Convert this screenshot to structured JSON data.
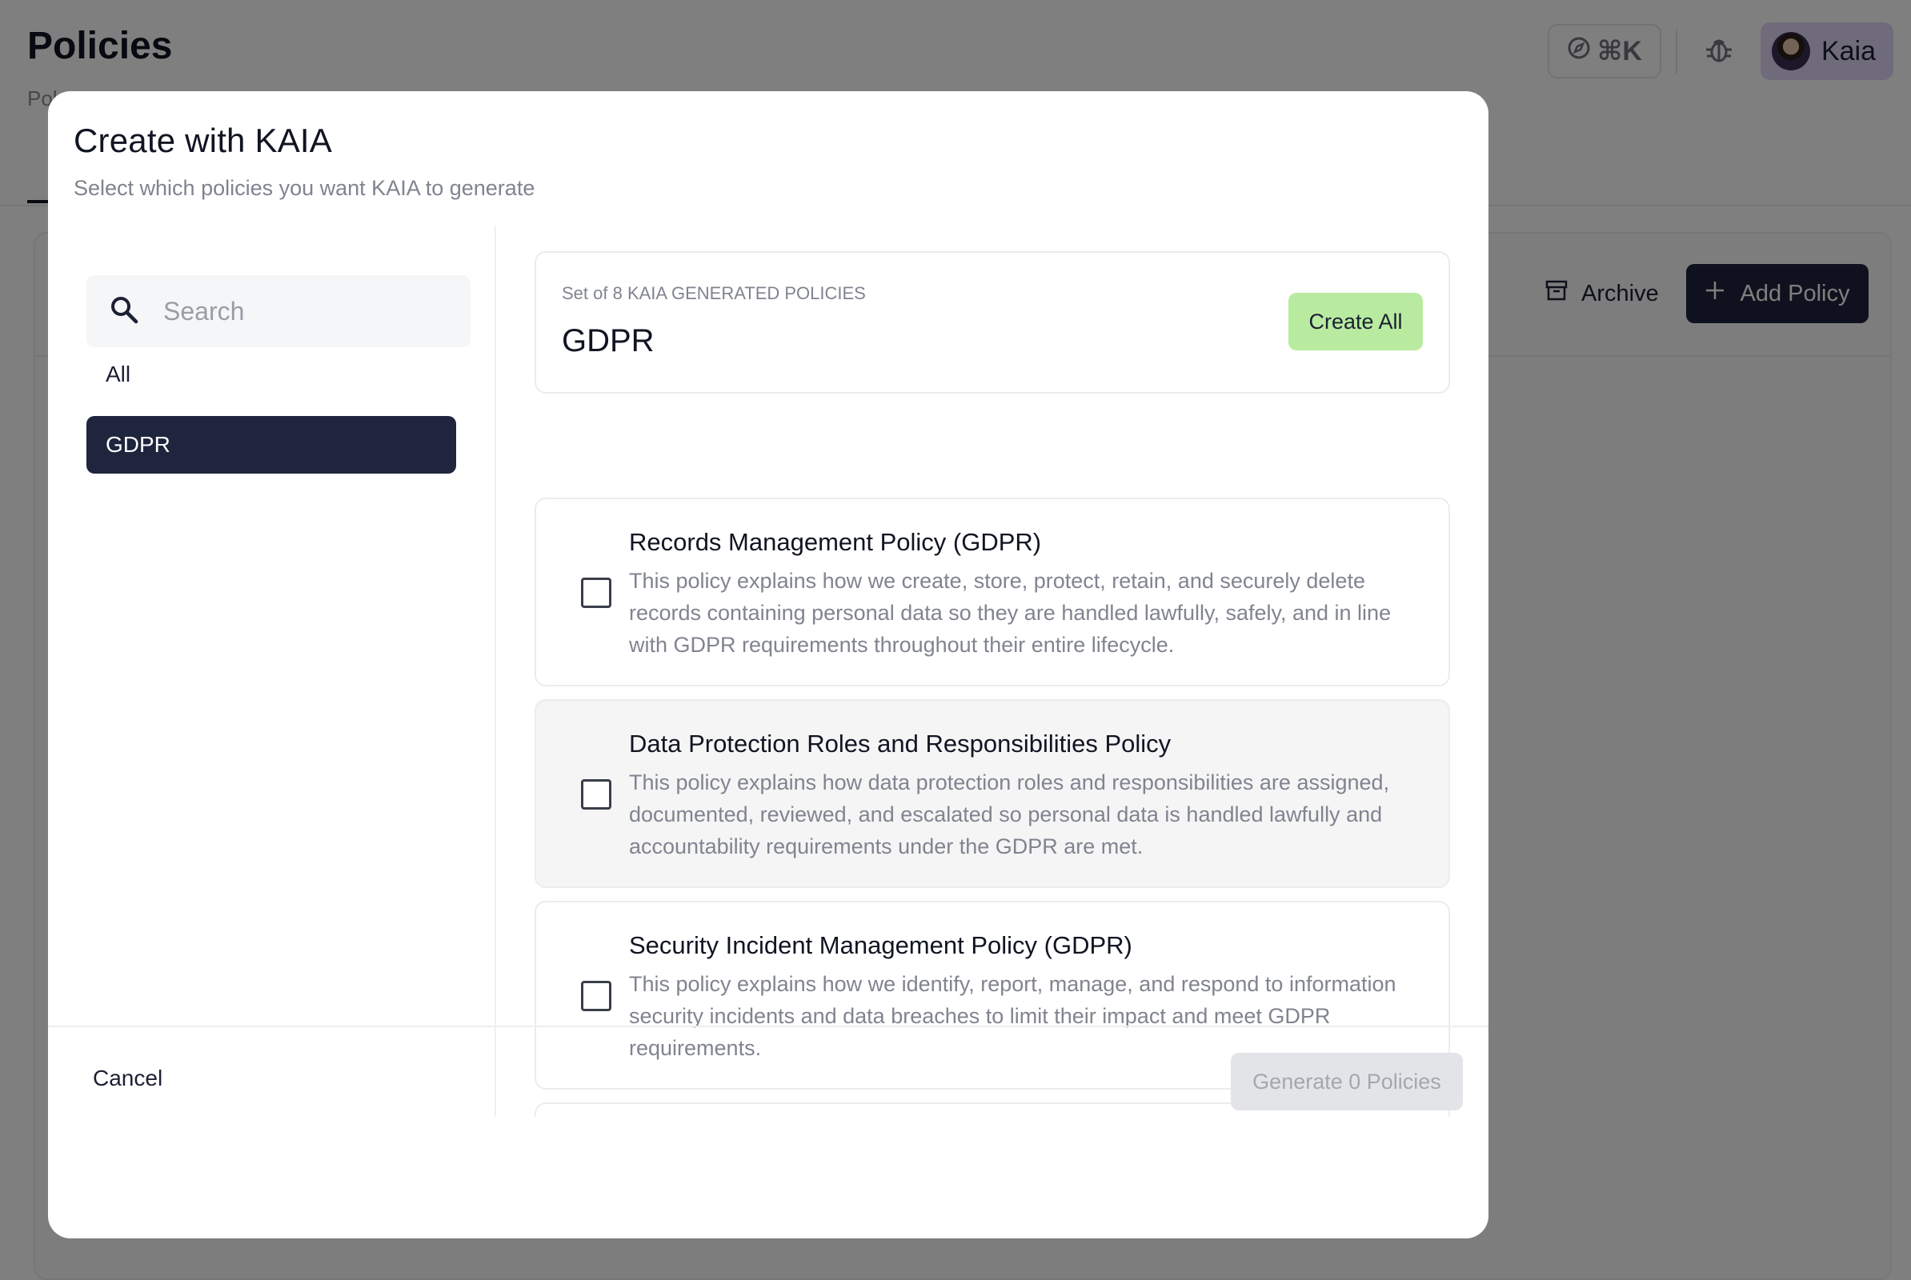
{
  "page": {
    "title": "Policies",
    "subtitle": "Pol"
  },
  "topbar": {
    "shortcut_label": "⌘K",
    "user_name": "Kaia"
  },
  "toolbar": {
    "archive_label": "Archive",
    "add_policy_label": "Add Policy"
  },
  "modal": {
    "title": "Create with KAIA",
    "subtitle": "Select which policies you want KAIA to generate",
    "search": {
      "placeholder": "Search",
      "value": ""
    },
    "sidebar": {
      "items": [
        {
          "label": "All",
          "active": false
        },
        {
          "label": "GDPR",
          "active": true
        }
      ]
    },
    "set": {
      "label": "Set of 8 KAIA GENERATED POLICIES",
      "name": "GDPR",
      "create_all_label": "Create All"
    },
    "policies": [
      {
        "title": "Records Management Policy (GDPR)",
        "description": "This policy explains how we create, store, protect, retain, and securely delete records containing personal data so they are handled lawfully, safely, and in line with GDPR requirements throughout their entire lifecycle.",
        "checked": false
      },
      {
        "title": "Data Protection Roles and Responsibilities Policy",
        "description": "This policy explains how data protection roles and responsibilities are assigned, documented, reviewed, and escalated so personal data is handled lawfully and accountability requirements under the GDPR are met.",
        "checked": false
      },
      {
        "title": "Security Incident Management Policy (GDPR)",
        "description": "This policy explains how we identify, report, manage, and respond to information security incidents and data breaches to limit their impact and meet GDPR requirements.",
        "checked": false
      }
    ],
    "footer": {
      "cancel_label": "Cancel",
      "generate_label": "Generate 0 Policies"
    }
  },
  "colors": {
    "primary_dark": "#1e253d",
    "create_all_bg": "#b8eba0",
    "user_chip_bg": "#ded7f5",
    "overlay": "rgba(0,0,0,0.5)",
    "muted_text": "#80848f"
  }
}
